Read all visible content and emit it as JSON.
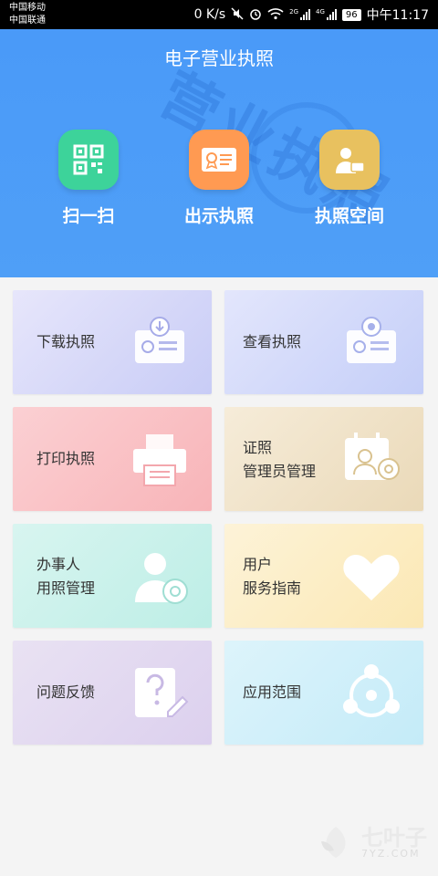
{
  "status_bar": {
    "carrier1": "中国移动",
    "carrier2": "中国联通",
    "net_speed": "0 K/s",
    "sim1_label": "2G",
    "sim2_label": "4G",
    "battery": "96",
    "time": "中午11:17"
  },
  "header": {
    "title": "电子营业执照",
    "watermark": "营业执照"
  },
  "actions": [
    {
      "label": "扫一扫",
      "icon": "qr-code-icon",
      "color": "#3dd39a"
    },
    {
      "label": "出示执照",
      "icon": "license-card-icon",
      "color": "#ff9a52"
    },
    {
      "label": "执照空间",
      "icon": "id-card-icon",
      "color": "#e8c15f"
    }
  ],
  "cards": [
    {
      "line1": "下载执照",
      "line2": "",
      "icon": "download-license-icon"
    },
    {
      "line1": "查看执照",
      "line2": "",
      "icon": "view-license-icon"
    },
    {
      "line1": "打印执照",
      "line2": "",
      "icon": "printer-icon"
    },
    {
      "line1": "证照",
      "line2": "管理员管理",
      "icon": "admin-manage-icon"
    },
    {
      "line1": "办事人",
      "line2": "用照管理",
      "icon": "user-settings-icon"
    },
    {
      "line1": "用户",
      "line2": "服务指南",
      "icon": "heart-icon"
    },
    {
      "line1": "问题反馈",
      "line2": "",
      "icon": "question-feedback-icon"
    },
    {
      "line1": "应用范围",
      "line2": "",
      "icon": "scope-icon"
    }
  ],
  "watermark_logo": {
    "name": "七叶子",
    "domain": "7YZ.COM"
  }
}
